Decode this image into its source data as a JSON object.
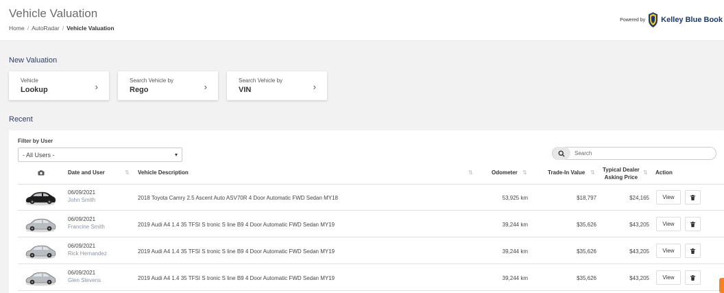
{
  "header": {
    "title": "Vehicle Valuation",
    "breadcrumb": [
      "Home",
      "AutoRadar",
      "Vehicle Valuation"
    ],
    "powered_by": "Powered by",
    "brand": "Kelley Blue Book"
  },
  "new_valuation": {
    "title": "New Valuation",
    "cards": [
      {
        "small": "Vehicle",
        "big": "Lookup"
      },
      {
        "small": "Search Vehicle by",
        "big": "Rego"
      },
      {
        "small": "Search Vehicle by",
        "big": "VIN"
      }
    ]
  },
  "recent": {
    "title": "Recent",
    "filter_label": "Filter by User",
    "filter_value": "- All Users -",
    "search_placeholder": "Search",
    "columns": {
      "date_user": "Date and User",
      "description": "Vehicle Description",
      "odometer": "Odometer",
      "trade_in": "Trade-In Value",
      "asking_line1": "Typical Dealer",
      "asking_line2": "Asking Price",
      "action": "Action"
    },
    "view_label": "View",
    "rows": [
      {
        "date": "06/09/2021",
        "user": "John Smith",
        "description": "2018 Toyota Camry 2.5 Ascent Auto ASV70R 4 Door Automatic FWD Sedan MY18",
        "odometer": "53,925 km",
        "trade_in": "$18,797",
        "asking": "$24,165",
        "car_color": "#1c1c1c"
      },
      {
        "date": "06/09/2021",
        "user": "Francine Smith",
        "description": "2019 Audi A4 1.4 35 TFSI S tronic S line B9 4 Door Automatic FWD Sedan MY19",
        "odometer": "39,244 km",
        "trade_in": "$35,626",
        "asking": "$43,205",
        "car_color": "#b9bcc0"
      },
      {
        "date": "06/09/2021",
        "user": "Rick Hernandez",
        "description": "2019 Audi A4 1.4 35 TFSI S tronic S line B9 4 Door Automatic FWD Sedan MY19",
        "odometer": "39,244 km",
        "trade_in": "$35,626",
        "asking": "$43,205",
        "car_color": "#b9bcc0"
      },
      {
        "date": "06/09/2021",
        "user": "Glen Stevens",
        "description": "2019 Audi A4 1.4 35 TFSI S tronic S line B9 4 Door Automatic FWD Sedan MY19",
        "odometer": "39,244 km",
        "trade_in": "$35,626",
        "asking": "$43,205",
        "car_color": "#b9bcc0"
      }
    ]
  },
  "colors": {
    "section_title": "#2d3e66",
    "user_text": "#8a94a6",
    "accent_tab": "#f58220"
  }
}
